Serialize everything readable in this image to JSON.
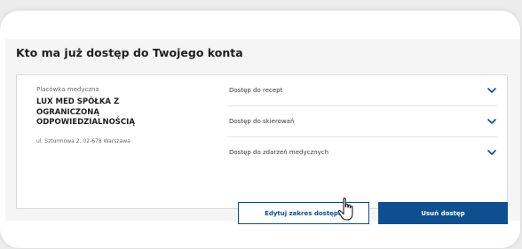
{
  "section": {
    "title": "Kto ma już dostęp do Twojego konta"
  },
  "facility": {
    "label": "Placówka medyczna",
    "name": "LUX MED SPÓŁKA Z OGRANICZONĄ ODPOWIEDZIALNOŚCIĄ",
    "address": "ul. Szturmowa 2, 02-678 Warszawa"
  },
  "access": {
    "items": [
      {
        "label": "Dostęp do recept",
        "icon": "chevron-down-icon"
      },
      {
        "label": "Dostęp do skierowań",
        "icon": "chevron-down-icon"
      },
      {
        "label": "Dostęp do zdarzeń medycznych",
        "icon": "chevron-down-icon"
      }
    ]
  },
  "actions": {
    "edit_label": "Edytuj zakres dostępu",
    "remove_label": "Usuń dostęp"
  },
  "colors": {
    "accent": "#0d4f8f",
    "panel_bg": "#f5f5f5",
    "page_bg": "#ececec"
  }
}
